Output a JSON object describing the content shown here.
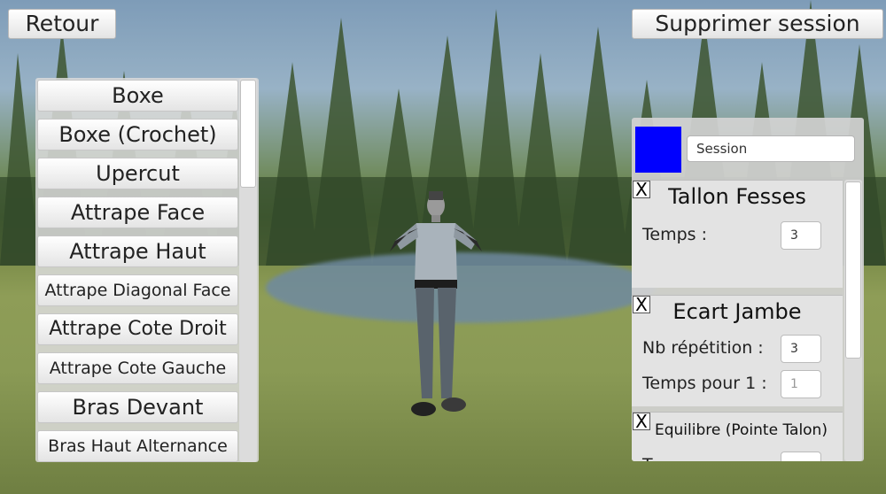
{
  "top_bar": {
    "back_label": "Retour",
    "delete_session_label": "Supprimer session"
  },
  "exercise_list": {
    "items": [
      {
        "label": "Boxe"
      },
      {
        "label": "Boxe (Crochet)"
      },
      {
        "label": "Upercut"
      },
      {
        "label": "Attrape Face"
      },
      {
        "label": "Attrape Haut"
      },
      {
        "label": "Attrape Diagonal Face"
      },
      {
        "label": "Attrape Cote Droit"
      },
      {
        "label": "Attrape Cote Gauche"
      },
      {
        "label": "Bras Devant"
      },
      {
        "label": "Bras Haut Alternance"
      }
    ],
    "scroll_position": 0
  },
  "session": {
    "color": "#0000ff",
    "name_value": "Session",
    "exercises": [
      {
        "close_label": "X",
        "title": "Tallon Fesses",
        "fields": [
          {
            "label": "Temps :",
            "value": "3",
            "is_placeholder": false
          }
        ]
      },
      {
        "close_label": "X",
        "title": "Ecart Jambe",
        "fields": [
          {
            "label": "Nb répétition :",
            "value": "3",
            "is_placeholder": false
          },
          {
            "label": "Temps pour 1 :",
            "value": "1",
            "is_placeholder": true
          }
        ]
      },
      {
        "close_label": "X",
        "title": "Equilibre (Pointe Talon)",
        "fields": [
          {
            "label": "T",
            "value": "",
            "is_placeholder": false
          }
        ]
      }
    ]
  },
  "colors": {
    "swatch": "#0000ff",
    "panel_bg": "#d2d2d2",
    "button_bg": "#f2f2f2"
  }
}
